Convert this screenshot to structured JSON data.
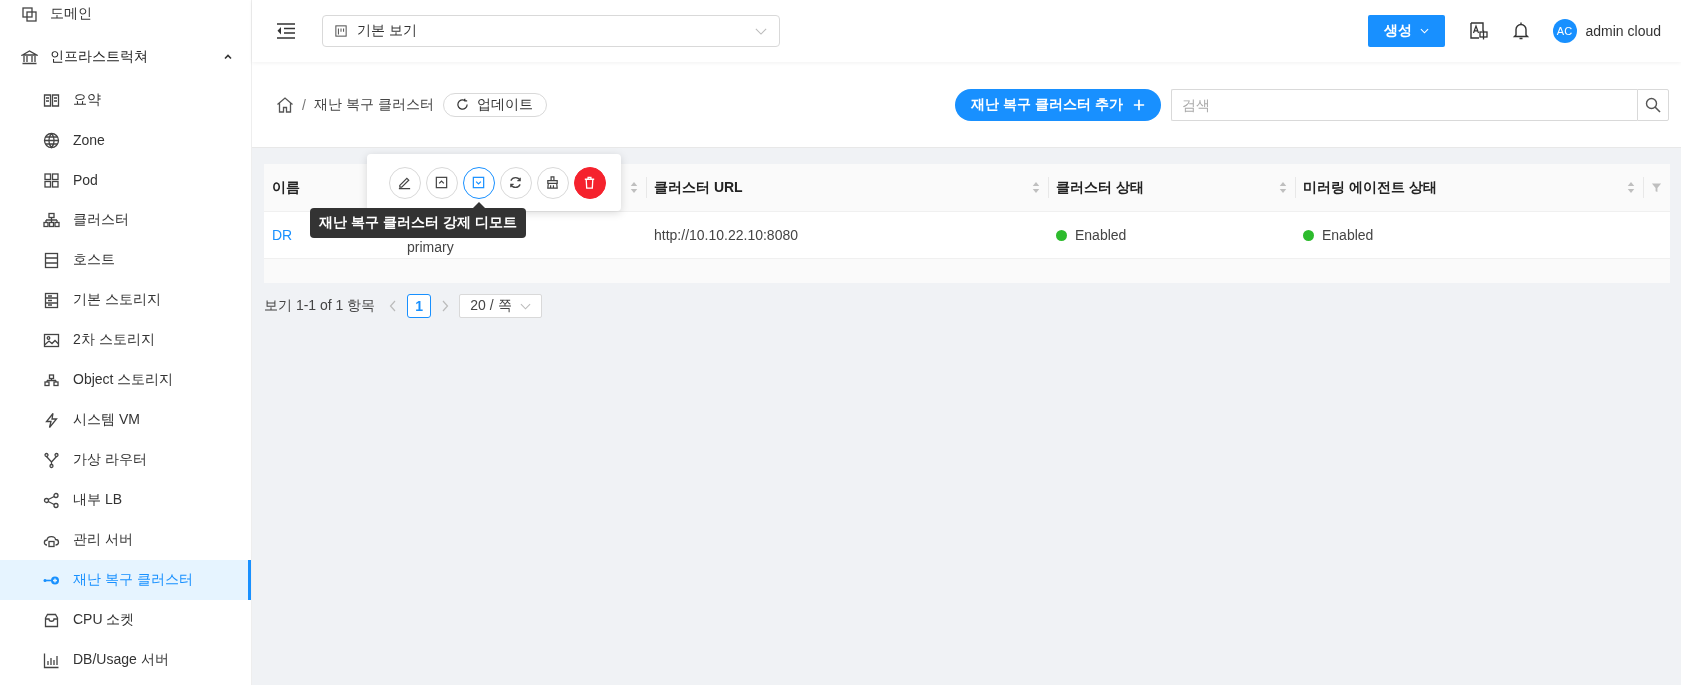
{
  "sidebar": {
    "items": [
      {
        "label": "도메인",
        "selected": false
      },
      {
        "label": "인프라스트럭쳐",
        "expanded": true,
        "selected": false,
        "children": [
          {
            "label": "요약",
            "selected": false
          },
          {
            "label": "Zone",
            "selected": false
          },
          {
            "label": "Pod",
            "selected": false
          },
          {
            "label": "클러스터",
            "selected": false
          },
          {
            "label": "호스트",
            "selected": false
          },
          {
            "label": "기본 스토리지",
            "selected": false
          },
          {
            "label": "2차 스토리지",
            "selected": false
          },
          {
            "label": "Object 스토리지",
            "selected": false
          },
          {
            "label": "시스템 VM",
            "selected": false
          },
          {
            "label": "가상 라우터",
            "selected": false
          },
          {
            "label": "내부 LB",
            "selected": false
          },
          {
            "label": "관리 서버",
            "selected": false
          },
          {
            "label": "재난 복구 클러스터",
            "selected": true
          },
          {
            "label": "CPU 소켓",
            "selected": false
          },
          {
            "label": "DB/Usage 서버",
            "selected": false
          }
        ]
      }
    ]
  },
  "top_bar": {
    "view_select": {
      "value": "기본 보기"
    },
    "create_button": "생성",
    "user": {
      "initials": "AC",
      "name": "admin cloud"
    }
  },
  "breadcrumb": {
    "current": "재난 복구 클러스터",
    "separator": "/",
    "refresh_button": "업데이트"
  },
  "add_button": "재난 복구 클러스터 추가",
  "search": {
    "placeholder": "검색"
  },
  "action_popover": {
    "actions": [
      {
        "kind": "edit",
        "selected": false
      },
      {
        "kind": "promote",
        "selected": false
      },
      {
        "kind": "demote",
        "selected": true
      },
      {
        "kind": "sync",
        "selected": false
      },
      {
        "kind": "clean",
        "selected": false
      },
      {
        "kind": "delete",
        "selected": false
      }
    ],
    "tooltip": "재난 복구 클러스터 강제 디모트"
  },
  "table": {
    "columns": [
      {
        "label": "이름",
        "sortable": false
      },
      {
        "sortable": true
      },
      {
        "label": "클러스터 URL",
        "sortable": true
      },
      {
        "label": "클러스터 상태",
        "sortable": true
      },
      {
        "label": "미러링 에이전트 상태",
        "sortable": true
      }
    ],
    "rows": [
      {
        "name": "DR",
        "column_2": "primary",
        "url": "http://10.10.22.10:8080",
        "cluster_status": {
          "text": "Enabled",
          "color": "#2dbb2d"
        },
        "mirroring_status": {
          "text": "Enabled",
          "color": "#2dbb2d"
        }
      }
    ]
  },
  "pagination": {
    "summary": "보기 1-1 of 1 항목",
    "pages": [
      {
        "label": "1",
        "selected": true
      }
    ],
    "page_size": "20 / 쪽"
  }
}
